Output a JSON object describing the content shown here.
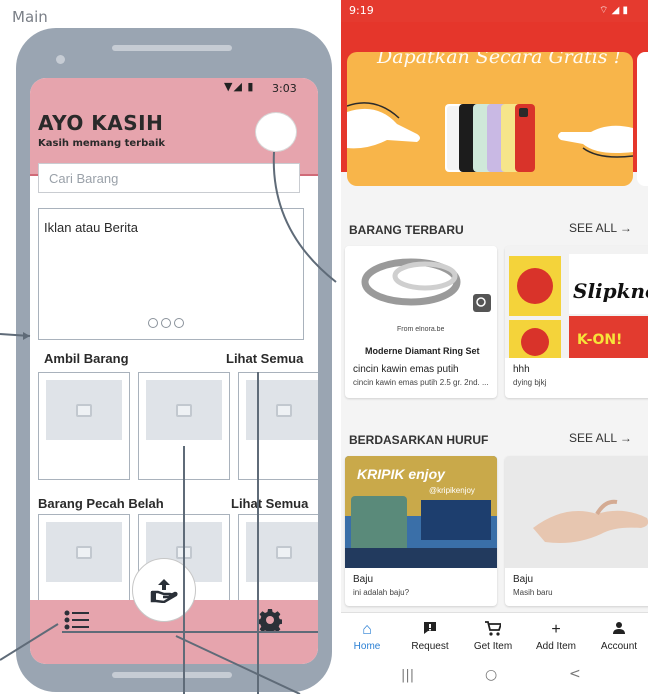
{
  "board": {
    "label": "Main"
  },
  "wireframe": {
    "status_time": "3:03",
    "status_icons": "▼◢ ▮",
    "app_title": "AYO KASIH",
    "app_subtitle": "Kasih memang terbaik",
    "search_placeholder": "Cari Barang",
    "ad_text": "Iklan atau  Berita",
    "section1": {
      "title": "Ambil Barang",
      "see_all": "Lihat Semua"
    },
    "section2": {
      "title": "Barang Pecah Belah",
      "see_all": "Lihat Semua"
    },
    "nav_icons": [
      "list-icon",
      "give-hand-icon",
      "gear-icon"
    ]
  },
  "app": {
    "status_time": "9:19",
    "status_right": "⌔ ◢ ▮",
    "banner_text": "Dapatkan Secara Gratis !",
    "section_new": {
      "title": "BARANG TERBARU",
      "see_all": "SEE ALL →"
    },
    "section_letter": {
      "title": "BERDASARKAN HURUF",
      "see_all": "SEE ALL →"
    },
    "new_items": [
      {
        "image_caption": "From elnora.be",
        "image_title": "Moderne Diamant Ring Set",
        "name": "cincin kawin emas putih",
        "desc": "cincin kawin emas putih 2.5 gr. 2nd. ..."
      },
      {
        "name": "hhh",
        "desc": "dying bjkj"
      }
    ],
    "letter_items": [
      {
        "image_text": "KRIPIK enjoy",
        "image_sub": "@kripikenjoy",
        "name": "Baju",
        "desc": "ini adalah baju?"
      },
      {
        "name": "Baju",
        "desc": "Masih baru"
      }
    ],
    "nav": [
      {
        "label": "Home",
        "icon": "home-icon",
        "active": true
      },
      {
        "label": "Request",
        "icon": "alert-icon"
      },
      {
        "label": "Get Item",
        "icon": "cart-icon"
      },
      {
        "label": "Add Item",
        "icon": "plus-icon"
      },
      {
        "label": "Account",
        "icon": "person-icon"
      }
    ],
    "sysbar": [
      "|||",
      "○",
      "<"
    ],
    "colors": {
      "accent": "#e5362b",
      "active_nav": "#2a7fd4",
      "wire_pink": "#e6a4ad"
    }
  }
}
